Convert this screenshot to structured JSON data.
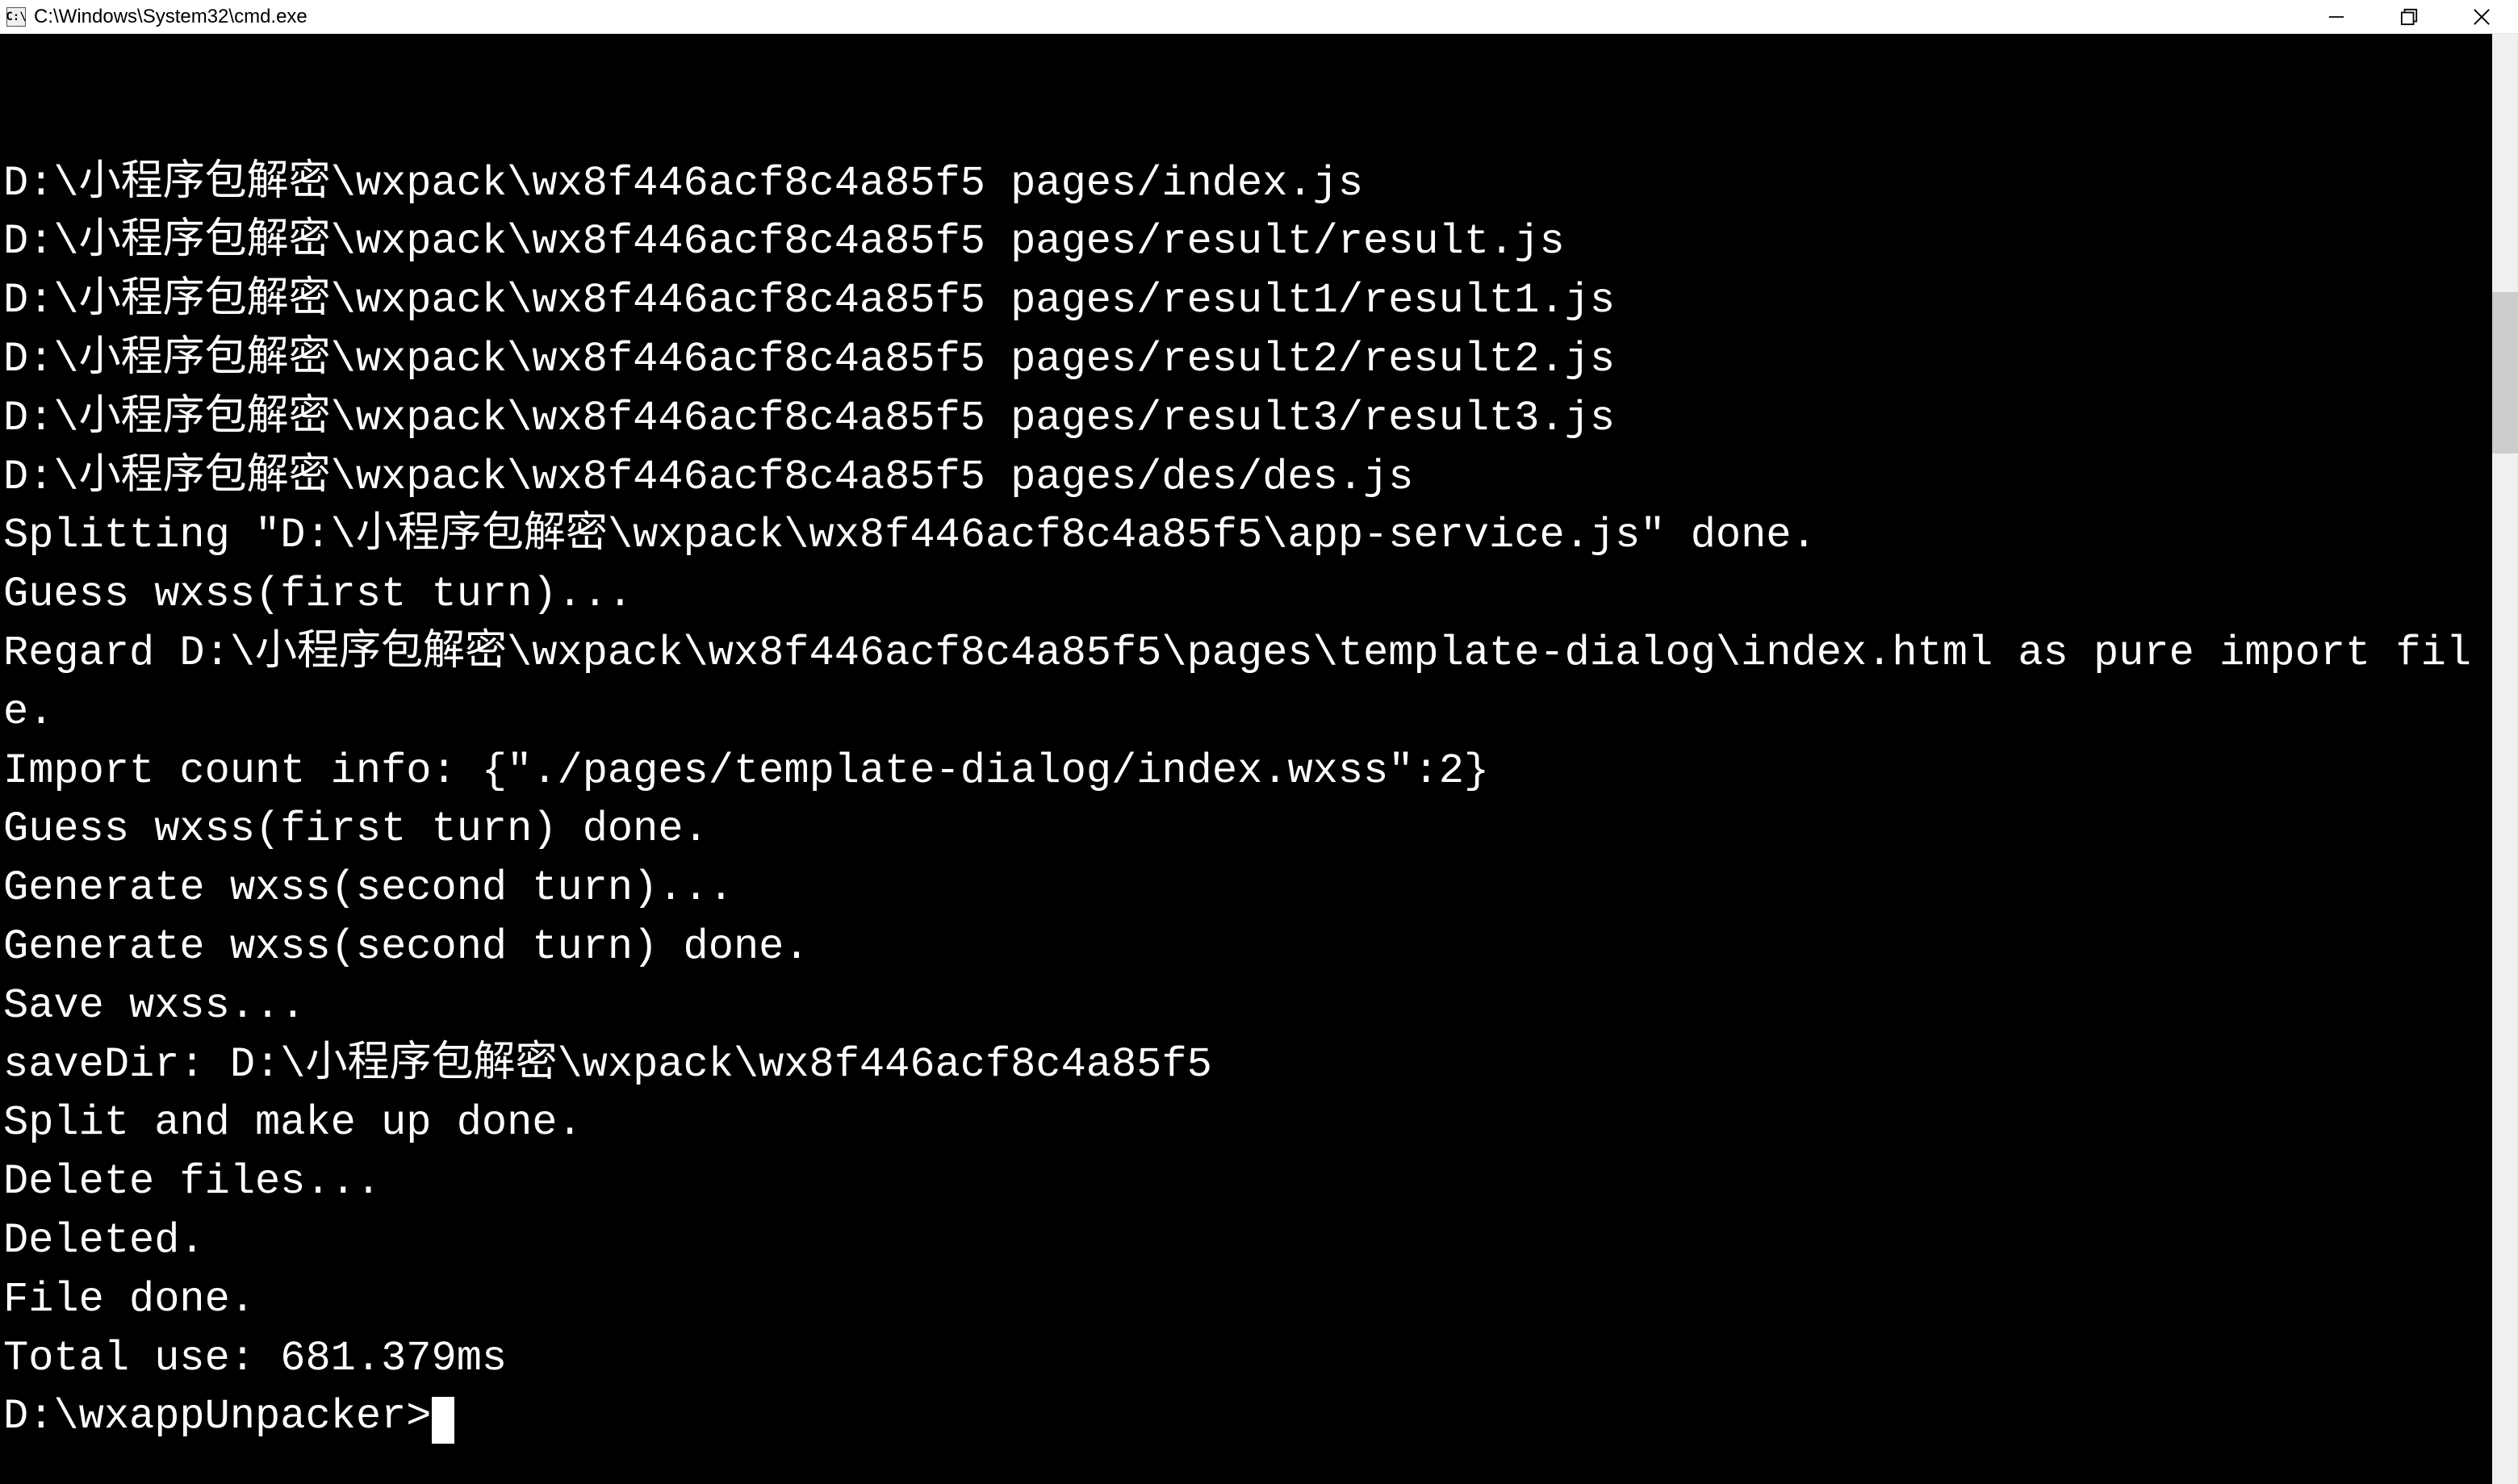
{
  "titlebar": {
    "icon_label": "C:\\",
    "title": "C:\\Windows\\System32\\cmd.exe"
  },
  "terminal": {
    "lines": [
      "D:\\小程序包解密\\wxpack\\wx8f446acf8c4a85f5 pages/index.js",
      "D:\\小程序包解密\\wxpack\\wx8f446acf8c4a85f5 pages/result/result.js",
      "D:\\小程序包解密\\wxpack\\wx8f446acf8c4a85f5 pages/result1/result1.js",
      "D:\\小程序包解密\\wxpack\\wx8f446acf8c4a85f5 pages/result2/result2.js",
      "D:\\小程序包解密\\wxpack\\wx8f446acf8c4a85f5 pages/result3/result3.js",
      "D:\\小程序包解密\\wxpack\\wx8f446acf8c4a85f5 pages/des/des.js",
      "Splitting \"D:\\小程序包解密\\wxpack\\wx8f446acf8c4a85f5\\app-service.js\" done.",
      "Guess wxss(first turn)...",
      "Regard D:\\小程序包解密\\wxpack\\wx8f446acf8c4a85f5\\pages\\template-dialog\\index.html as pure import file.",
      "Import count info: {\"./pages/template-dialog/index.wxss\":2}",
      "Guess wxss(first turn) done.",
      "Generate wxss(second turn)...",
      "Generate wxss(second turn) done.",
      "Save wxss...",
      "saveDir: D:\\小程序包解密\\wxpack\\wx8f446acf8c4a85f5",
      "Split and make up done.",
      "Delete files...",
      "Deleted.",
      "",
      "File done.",
      "Total use: 681.379ms",
      ""
    ],
    "prompt": "D:\\wxappUnpacker>"
  }
}
